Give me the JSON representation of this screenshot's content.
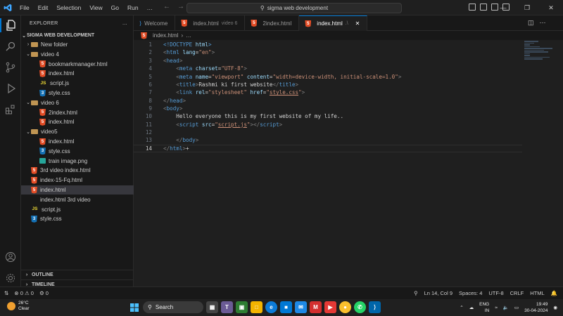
{
  "titlebar": {
    "menus": [
      "File",
      "Edit",
      "Selection",
      "View",
      "Go",
      "Run",
      "…"
    ],
    "search_text": "sigma web development",
    "back_icon": "arrow-left-icon",
    "forward_icon": "arrow-right-icon"
  },
  "sidebar": {
    "title": "EXPLORER",
    "more": "…",
    "workspace": "SIGMA WEB DEVELOPMENT",
    "tree": [
      {
        "label": "New folder",
        "type": "folder",
        "depth": 1,
        "expanded": false
      },
      {
        "label": "video 4",
        "type": "folder",
        "depth": 1,
        "expanded": true
      },
      {
        "label": "bookmarkmanager.html",
        "type": "html",
        "depth": 2
      },
      {
        "label": "index.html",
        "type": "html",
        "depth": 2
      },
      {
        "label": "script.js",
        "type": "js",
        "depth": 2
      },
      {
        "label": "style.css",
        "type": "css",
        "depth": 2
      },
      {
        "label": "video 6",
        "type": "folder",
        "depth": 1,
        "expanded": true
      },
      {
        "label": "2index.html",
        "type": "html",
        "depth": 2
      },
      {
        "label": "index.html",
        "type": "html",
        "depth": 2
      },
      {
        "label": "video5",
        "type": "folder",
        "depth": 1,
        "expanded": true
      },
      {
        "label": "index.html",
        "type": "html",
        "depth": 2
      },
      {
        "label": "style.css",
        "type": "css",
        "depth": 2
      },
      {
        "label": "train image.png",
        "type": "image",
        "depth": 2
      },
      {
        "label": "3rd video index.html",
        "type": "html",
        "depth": 1
      },
      {
        "label": "index-15-Fq.html",
        "type": "html",
        "depth": 1
      },
      {
        "label": "index.html",
        "type": "html",
        "depth": 1,
        "selected": true
      },
      {
        "label": "index.html 3rd video",
        "type": "file",
        "depth": 1
      },
      {
        "label": "script.js",
        "type": "js",
        "depth": 1
      },
      {
        "label": "style.css",
        "type": "css",
        "depth": 1
      }
    ],
    "outline": "OUTLINE",
    "timeline": "TIMELINE"
  },
  "tabs": [
    {
      "label": "Welcome",
      "desc": "",
      "icon": "vscode-icon",
      "active": false
    },
    {
      "label": "index.html",
      "desc": "video 6",
      "icon": "html-icon",
      "active": false
    },
    {
      "label": "2index.html",
      "desc": "",
      "icon": "html-icon",
      "active": false
    },
    {
      "label": "index.html",
      "desc": ".\\",
      "icon": "html-icon",
      "active": true
    }
  ],
  "breadcrumb": {
    "file": "index.html",
    "rest": "…"
  },
  "code": [
    [
      [
        "<!DOCTYPE ",
        "t-tag"
      ],
      [
        "html",
        "t-attr"
      ],
      [
        ">",
        "t-tag"
      ]
    ],
    [
      [
        "<",
        "t-punc"
      ],
      [
        "html ",
        "t-tag"
      ],
      [
        "lang",
        "t-attr"
      ],
      [
        "=",
        "t-txt"
      ],
      [
        "\"en\"",
        "t-str"
      ],
      [
        ">",
        "t-punc"
      ]
    ],
    [
      [
        "<",
        "t-punc"
      ],
      [
        "head",
        "t-tag"
      ],
      [
        ">",
        "t-punc"
      ]
    ],
    [
      [
        "    ",
        "t-txt"
      ],
      [
        "<",
        "t-punc"
      ],
      [
        "meta ",
        "t-tag"
      ],
      [
        "charset",
        "t-attr"
      ],
      [
        "=",
        "t-txt"
      ],
      [
        "\"UTF-8\"",
        "t-str"
      ],
      [
        ">",
        "t-punc"
      ]
    ],
    [
      [
        "    ",
        "t-txt"
      ],
      [
        "<",
        "t-punc"
      ],
      [
        "meta ",
        "t-tag"
      ],
      [
        "name",
        "t-attr"
      ],
      [
        "=",
        "t-txt"
      ],
      [
        "\"viewport\" ",
        "t-str"
      ],
      [
        "content",
        "t-attr"
      ],
      [
        "=",
        "t-txt"
      ],
      [
        "\"width=device-width, initial-scale=1.0\"",
        "t-str"
      ],
      [
        ">",
        "t-punc"
      ]
    ],
    [
      [
        "    ",
        "t-txt"
      ],
      [
        "<",
        "t-punc"
      ],
      [
        "title",
        "t-tag"
      ],
      [
        ">",
        "t-punc"
      ],
      [
        "Rashmi ki first website",
        "t-txt"
      ],
      [
        "</",
        "t-punc"
      ],
      [
        "title",
        "t-tag"
      ],
      [
        ">",
        "t-punc"
      ]
    ],
    [
      [
        "    ",
        "t-txt"
      ],
      [
        "<",
        "t-punc"
      ],
      [
        "link ",
        "t-tag"
      ],
      [
        "rel",
        "t-attr"
      ],
      [
        "=",
        "t-txt"
      ],
      [
        "\"stylesheet\" ",
        "t-str"
      ],
      [
        "href",
        "t-attr"
      ],
      [
        "=",
        "t-txt"
      ],
      [
        "\"",
        "t-str"
      ],
      [
        "style.css",
        "t-str t-link"
      ],
      [
        "\"",
        "t-str"
      ],
      [
        ">",
        "t-punc"
      ]
    ],
    [
      [
        "</",
        "t-punc"
      ],
      [
        "head",
        "t-tag"
      ],
      [
        ">",
        "t-punc"
      ]
    ],
    [
      [
        "<",
        "t-punc"
      ],
      [
        "body",
        "t-tag"
      ],
      [
        ">",
        "t-punc"
      ]
    ],
    [
      [
        "    Hello everyone this is my first website of my life..",
        "t-txt"
      ]
    ],
    [
      [
        "    ",
        "t-txt"
      ],
      [
        "<",
        "t-punc"
      ],
      [
        "script ",
        "t-tag"
      ],
      [
        "src",
        "t-attr"
      ],
      [
        "=",
        "t-txt"
      ],
      [
        "\"",
        "t-str"
      ],
      [
        "script.js",
        "t-str t-link"
      ],
      [
        "\"",
        "t-str"
      ],
      [
        "></",
        "t-punc"
      ],
      [
        "script",
        "t-tag"
      ],
      [
        ">",
        "t-punc"
      ]
    ],
    [
      [
        "",
        "t-txt"
      ]
    ],
    [
      [
        "    ",
        "t-txt"
      ],
      [
        "</",
        "t-punc"
      ],
      [
        "body",
        "t-tag"
      ],
      [
        ">",
        "t-punc"
      ]
    ],
    [
      [
        "</",
        "t-punc"
      ],
      [
        "html",
        "t-tag"
      ],
      [
        ">",
        "t-punc"
      ],
      [
        "+",
        "t-txt"
      ]
    ]
  ],
  "current_line": 14,
  "status": {
    "errors": "0",
    "warnings": "0",
    "ports": "0",
    "position": "Ln 14, Col 9",
    "spaces": "Spaces: 4",
    "encoding": "UTF-8",
    "eol": "CRLF",
    "language": "HTML"
  },
  "taskbar": {
    "weather_temp": "26°C",
    "weather_desc": "Clear",
    "search_label": "Search",
    "lang_top": "ENG",
    "lang_bottom": "IN",
    "time": "19:49",
    "date": "30-04-2024"
  }
}
